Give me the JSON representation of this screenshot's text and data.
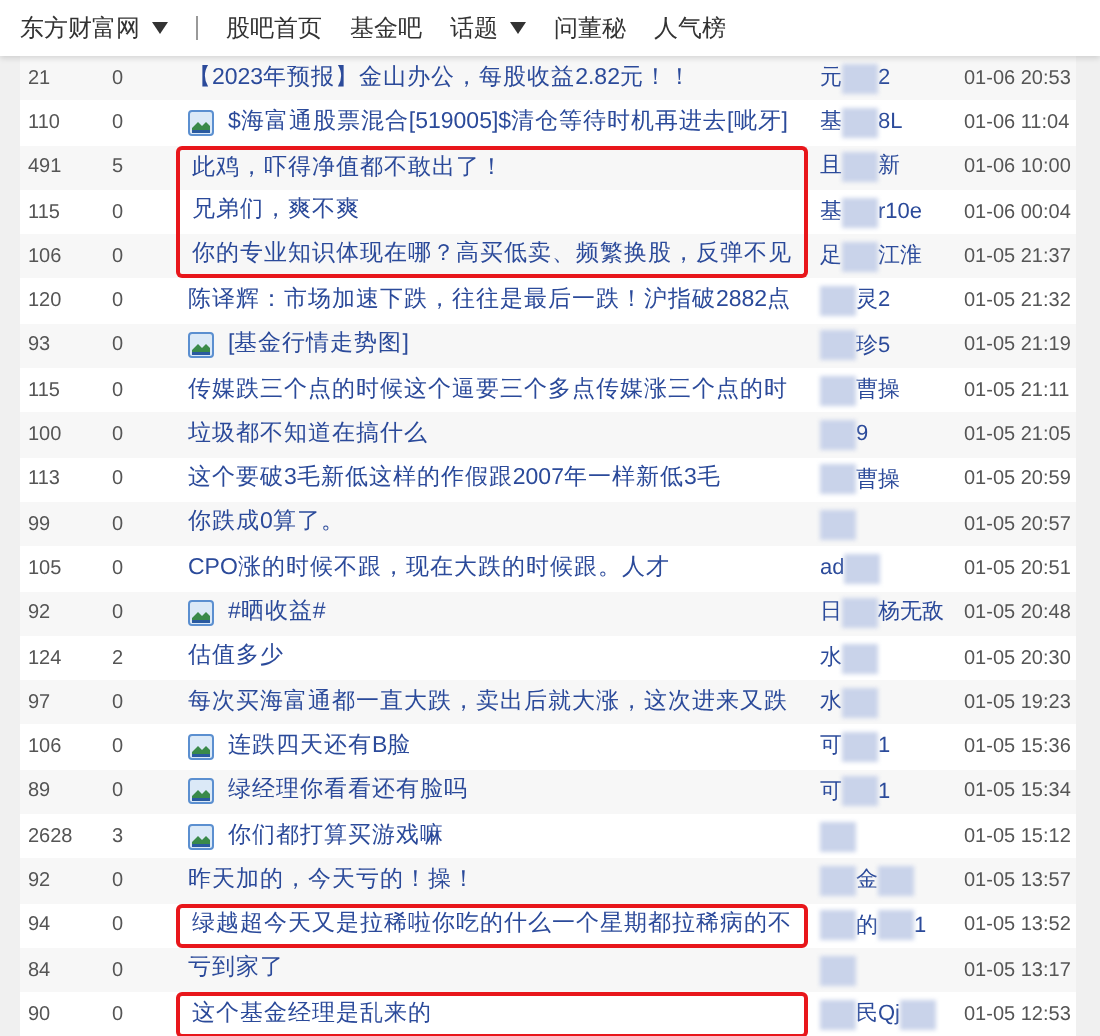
{
  "nav": [
    {
      "label": "东方财富网",
      "dropdown": true
    },
    {
      "label": "股吧首页",
      "dropdown": false
    },
    {
      "label": "基金吧",
      "dropdown": false
    },
    {
      "label": "话题",
      "dropdown": true
    },
    {
      "label": "问董秘",
      "dropdown": false
    },
    {
      "label": "人气榜",
      "dropdown": false
    }
  ],
  "posts": [
    {
      "reads": "21",
      "replies": "0",
      "image": false,
      "title": "【2023年预报】金山办公，每股收益2.82元！！",
      "highlighted": false,
      "author": [
        {
          "kind": "text",
          "text": "元"
        },
        {
          "kind": "blur"
        },
        {
          "kind": "text",
          "text": "2"
        }
      ],
      "time": "01-06 20:53"
    },
    {
      "reads": "110",
      "replies": "0",
      "image": true,
      "title": "$海富通股票混合[519005]$清仓等待时机再进去[呲牙]",
      "highlighted": false,
      "author": [
        {
          "kind": "text",
          "text": "基"
        },
        {
          "kind": "blur"
        },
        {
          "kind": "text",
          "text": "8L"
        }
      ],
      "time": "01-06 11:04"
    },
    {
      "reads": "491",
      "replies": "5",
      "image": false,
      "title": "此鸡，吓得净值都不敢出了！",
      "highlighted": true,
      "author": [
        {
          "kind": "text",
          "text": "且"
        },
        {
          "kind": "blur"
        },
        {
          "kind": "text",
          "text": "新"
        }
      ],
      "time": "01-06 10:00"
    },
    {
      "reads": "115",
      "replies": "0",
      "image": false,
      "title": "兄弟们，爽不爽",
      "highlighted": true,
      "author": [
        {
          "kind": "text",
          "text": "基"
        },
        {
          "kind": "blur"
        },
        {
          "kind": "text",
          "text": "r10e"
        }
      ],
      "time": "01-06 00:04"
    },
    {
      "reads": "106",
      "replies": "0",
      "image": false,
      "title": "你的专业知识体现在哪？高买低卖、频繁换股，反弹不见",
      "highlighted": true,
      "author": [
        {
          "kind": "text",
          "text": "足"
        },
        {
          "kind": "blur"
        },
        {
          "kind": "text",
          "text": "江淮"
        }
      ],
      "time": "01-05 21:37"
    },
    {
      "reads": "120",
      "replies": "0",
      "image": false,
      "title": "陈译辉：市场加速下跌，往往是最后一跌！沪指破2882点",
      "highlighted": false,
      "author": [
        {
          "kind": "blur"
        },
        {
          "kind": "text",
          "text": "灵2"
        }
      ],
      "time": "01-05 21:32"
    },
    {
      "reads": "93",
      "replies": "0",
      "image": true,
      "title": "[基金行情走势图]",
      "highlighted": false,
      "author": [
        {
          "kind": "blur"
        },
        {
          "kind": "text",
          "text": "珍5"
        }
      ],
      "time": "01-05 21:19"
    },
    {
      "reads": "115",
      "replies": "0",
      "image": false,
      "title": "传媒跌三个点的时候这个逼要三个多点传媒涨三个点的时",
      "highlighted": false,
      "author": [
        {
          "kind": "blur"
        },
        {
          "kind": "text",
          "text": "曹操"
        }
      ],
      "time": "01-05 21:11"
    },
    {
      "reads": "100",
      "replies": "0",
      "image": false,
      "title": "垃圾都不知道在搞什么",
      "highlighted": false,
      "author": [
        {
          "kind": "blur"
        },
        {
          "kind": "text",
          "text": "9"
        }
      ],
      "time": "01-05 21:05"
    },
    {
      "reads": "113",
      "replies": "0",
      "image": false,
      "title": "这个要破3毛新低这样的作假跟2007年一样新低3毛",
      "highlighted": false,
      "author": [
        {
          "kind": "blur"
        },
        {
          "kind": "text",
          "text": "曹操"
        }
      ],
      "time": "01-05 20:59"
    },
    {
      "reads": "99",
      "replies": "0",
      "image": false,
      "title": "你跌成0算了。",
      "highlighted": false,
      "author": [
        {
          "kind": "blur"
        }
      ],
      "time": "01-05 20:57"
    },
    {
      "reads": "105",
      "replies": "0",
      "image": false,
      "title": "CPO涨的时候不跟，现在大跌的时候跟。人才",
      "highlighted": false,
      "author": [
        {
          "kind": "text",
          "text": "ad"
        },
        {
          "kind": "blur"
        }
      ],
      "time": "01-05 20:51"
    },
    {
      "reads": "92",
      "replies": "0",
      "image": true,
      "title": "#晒收益#",
      "highlighted": false,
      "author": [
        {
          "kind": "text",
          "text": "日"
        },
        {
          "kind": "blur"
        },
        {
          "kind": "text",
          "text": "杨无敌"
        }
      ],
      "time": "01-05 20:48"
    },
    {
      "reads": "124",
      "replies": "2",
      "image": false,
      "title": "估值多少",
      "highlighted": false,
      "author": [
        {
          "kind": "text",
          "text": "水"
        },
        {
          "kind": "blur"
        }
      ],
      "time": "01-05 20:30"
    },
    {
      "reads": "97",
      "replies": "0",
      "image": false,
      "title": "每次买海富通都一直大跌，卖出后就大涨，这次进来又跌",
      "highlighted": false,
      "author": [
        {
          "kind": "text",
          "text": "水"
        },
        {
          "kind": "blur"
        }
      ],
      "time": "01-05 19:23"
    },
    {
      "reads": "106",
      "replies": "0",
      "image": true,
      "title": "连跌四天还有B脸",
      "highlighted": false,
      "author": [
        {
          "kind": "text",
          "text": "可"
        },
        {
          "kind": "blur"
        },
        {
          "kind": "text",
          "text": "1"
        }
      ],
      "time": "01-05 15:36"
    },
    {
      "reads": "89",
      "replies": "0",
      "image": true,
      "title": "绿经理你看看还有脸吗",
      "highlighted": false,
      "author": [
        {
          "kind": "text",
          "text": "可"
        },
        {
          "kind": "blur"
        },
        {
          "kind": "text",
          "text": "1"
        }
      ],
      "time": "01-05 15:34"
    },
    {
      "reads": "2628",
      "replies": "3",
      "image": true,
      "title": "你们都打算买游戏嘛",
      "highlighted": false,
      "author": [
        {
          "kind": "blur"
        }
      ],
      "time": "01-05 15:12"
    },
    {
      "reads": "92",
      "replies": "0",
      "image": false,
      "title": "昨天加的，今天亏的！操！",
      "highlighted": false,
      "author": [
        {
          "kind": "blur"
        },
        {
          "kind": "text",
          "text": "金"
        },
        {
          "kind": "blur"
        }
      ],
      "time": "01-05 13:57"
    },
    {
      "reads": "94",
      "replies": "0",
      "image": false,
      "title": "绿越超今天又是拉稀啦你吃的什么一个星期都拉稀病的不",
      "highlighted": true,
      "author": [
        {
          "kind": "blur"
        },
        {
          "kind": "text",
          "text": "的"
        },
        {
          "kind": "blur"
        },
        {
          "kind": "text",
          "text": "1"
        }
      ],
      "time": "01-05 13:52"
    },
    {
      "reads": "84",
      "replies": "0",
      "image": false,
      "title": "亏到家了",
      "highlighted": false,
      "author": [
        {
          "kind": "blur"
        }
      ],
      "time": "01-05 13:17"
    },
    {
      "reads": "90",
      "replies": "0",
      "image": false,
      "title": "这个基金经理是乱来的",
      "highlighted": true,
      "author": [
        {
          "kind": "blur"
        },
        {
          "kind": "text",
          "text": "民Qj"
        },
        {
          "kind": "blur"
        }
      ],
      "time": "01-05 12:53"
    }
  ]
}
